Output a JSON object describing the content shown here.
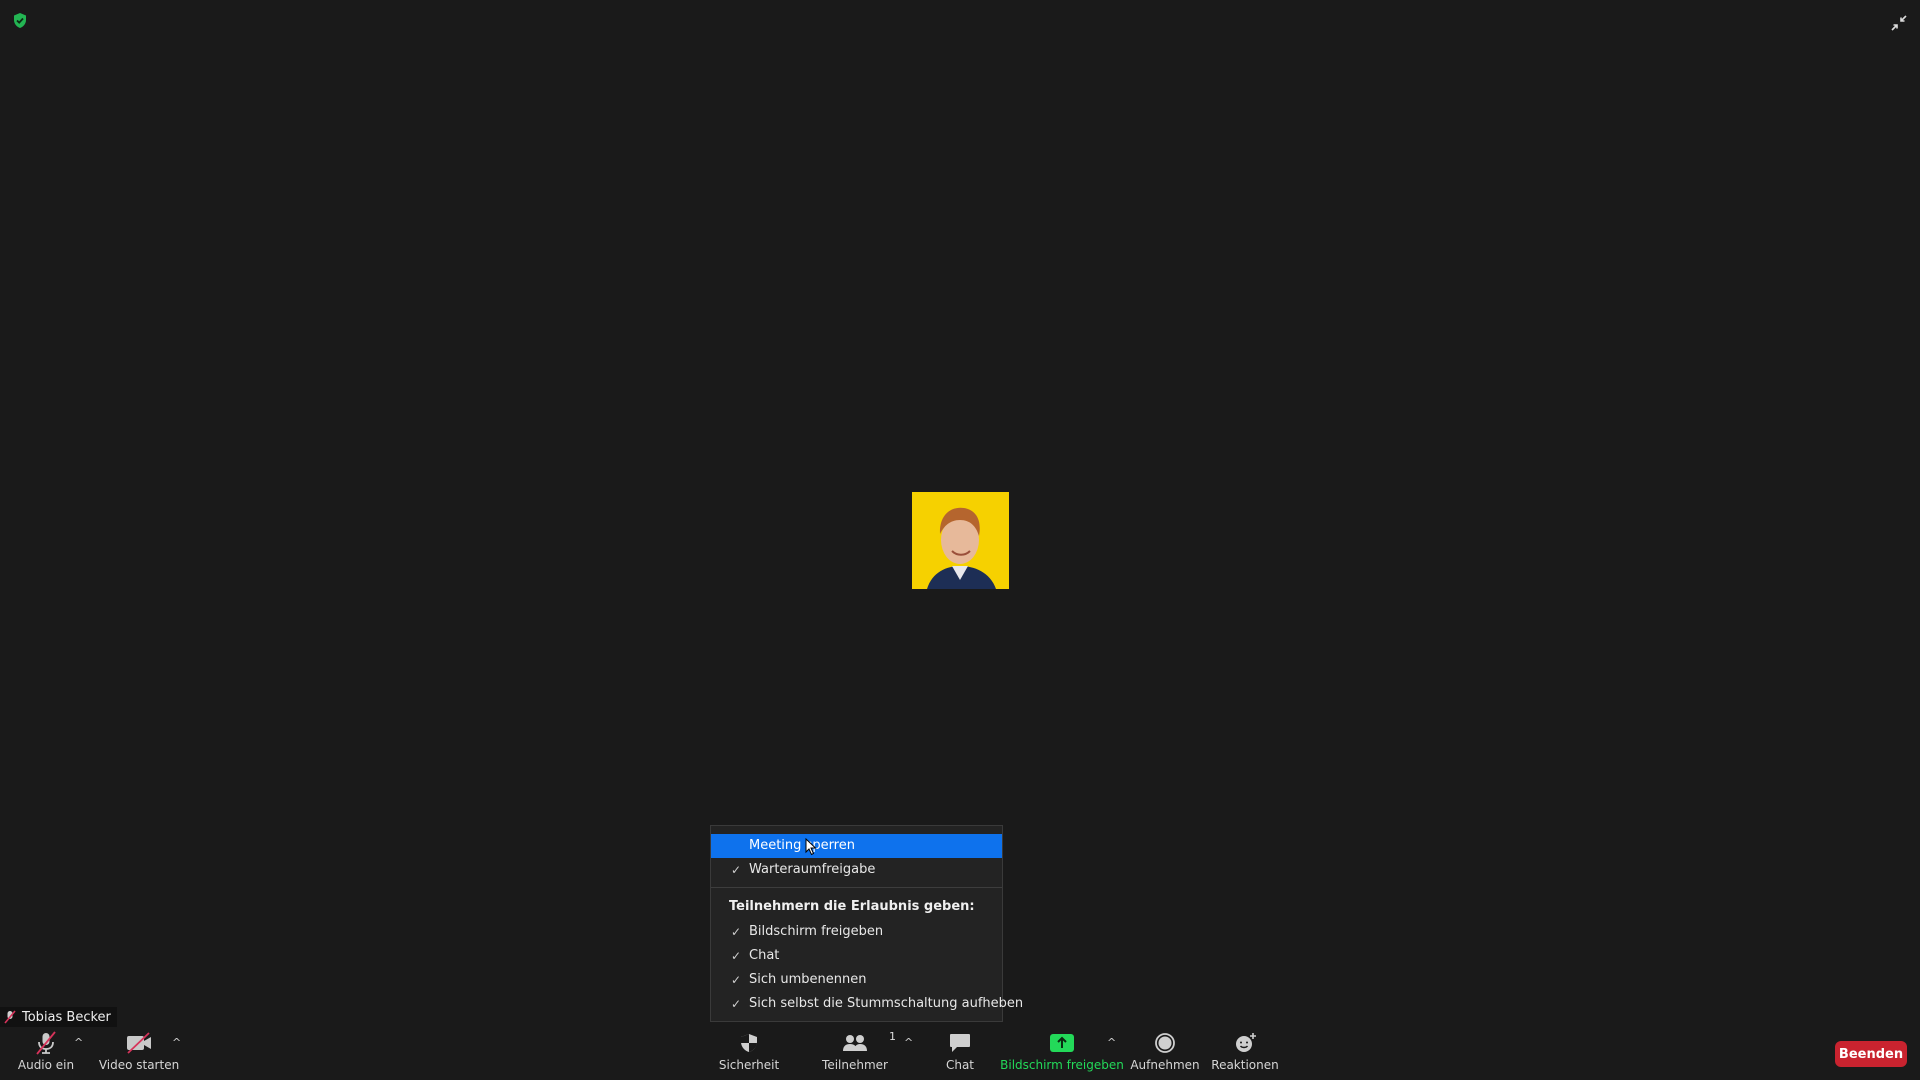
{
  "top": {
    "shield_icon": "encryption-shield-icon",
    "exit_fullscreen_icon": "exit-fullscreen-icon"
  },
  "participant": {
    "name": "Tobias Becker",
    "muted": true
  },
  "security_menu": {
    "items": [
      {
        "label": "Meeting sperren",
        "checked": false,
        "highlighted": true
      },
      {
        "label": "Warteraumfreigabe",
        "checked": true,
        "highlighted": false
      }
    ],
    "permissions_header": "Teilnehmern die Erlaubnis geben:",
    "permissions": [
      {
        "label": "Bildschirm freigeben",
        "checked": true
      },
      {
        "label": "Chat",
        "checked": true
      },
      {
        "label": "Sich umbenennen",
        "checked": true
      },
      {
        "label": "Sich selbst die Stummschaltung aufheben",
        "checked": true
      }
    ],
    "check_glyph": "✓"
  },
  "toolbar": {
    "audio": "Audio ein",
    "video": "Video starten",
    "security": "Sicherheit",
    "participants": "Teilnehmer",
    "participants_count": "1",
    "chat": "Chat",
    "share": "Bildschirm freigeben",
    "record": "Aufnehmen",
    "reactions": "Reaktionen",
    "end": "Beenden",
    "caret": "^"
  },
  "colors": {
    "accent": "#0e72ed",
    "share_green": "#23d959",
    "end_red": "#c9232f",
    "muted_red": "#d6335a"
  }
}
